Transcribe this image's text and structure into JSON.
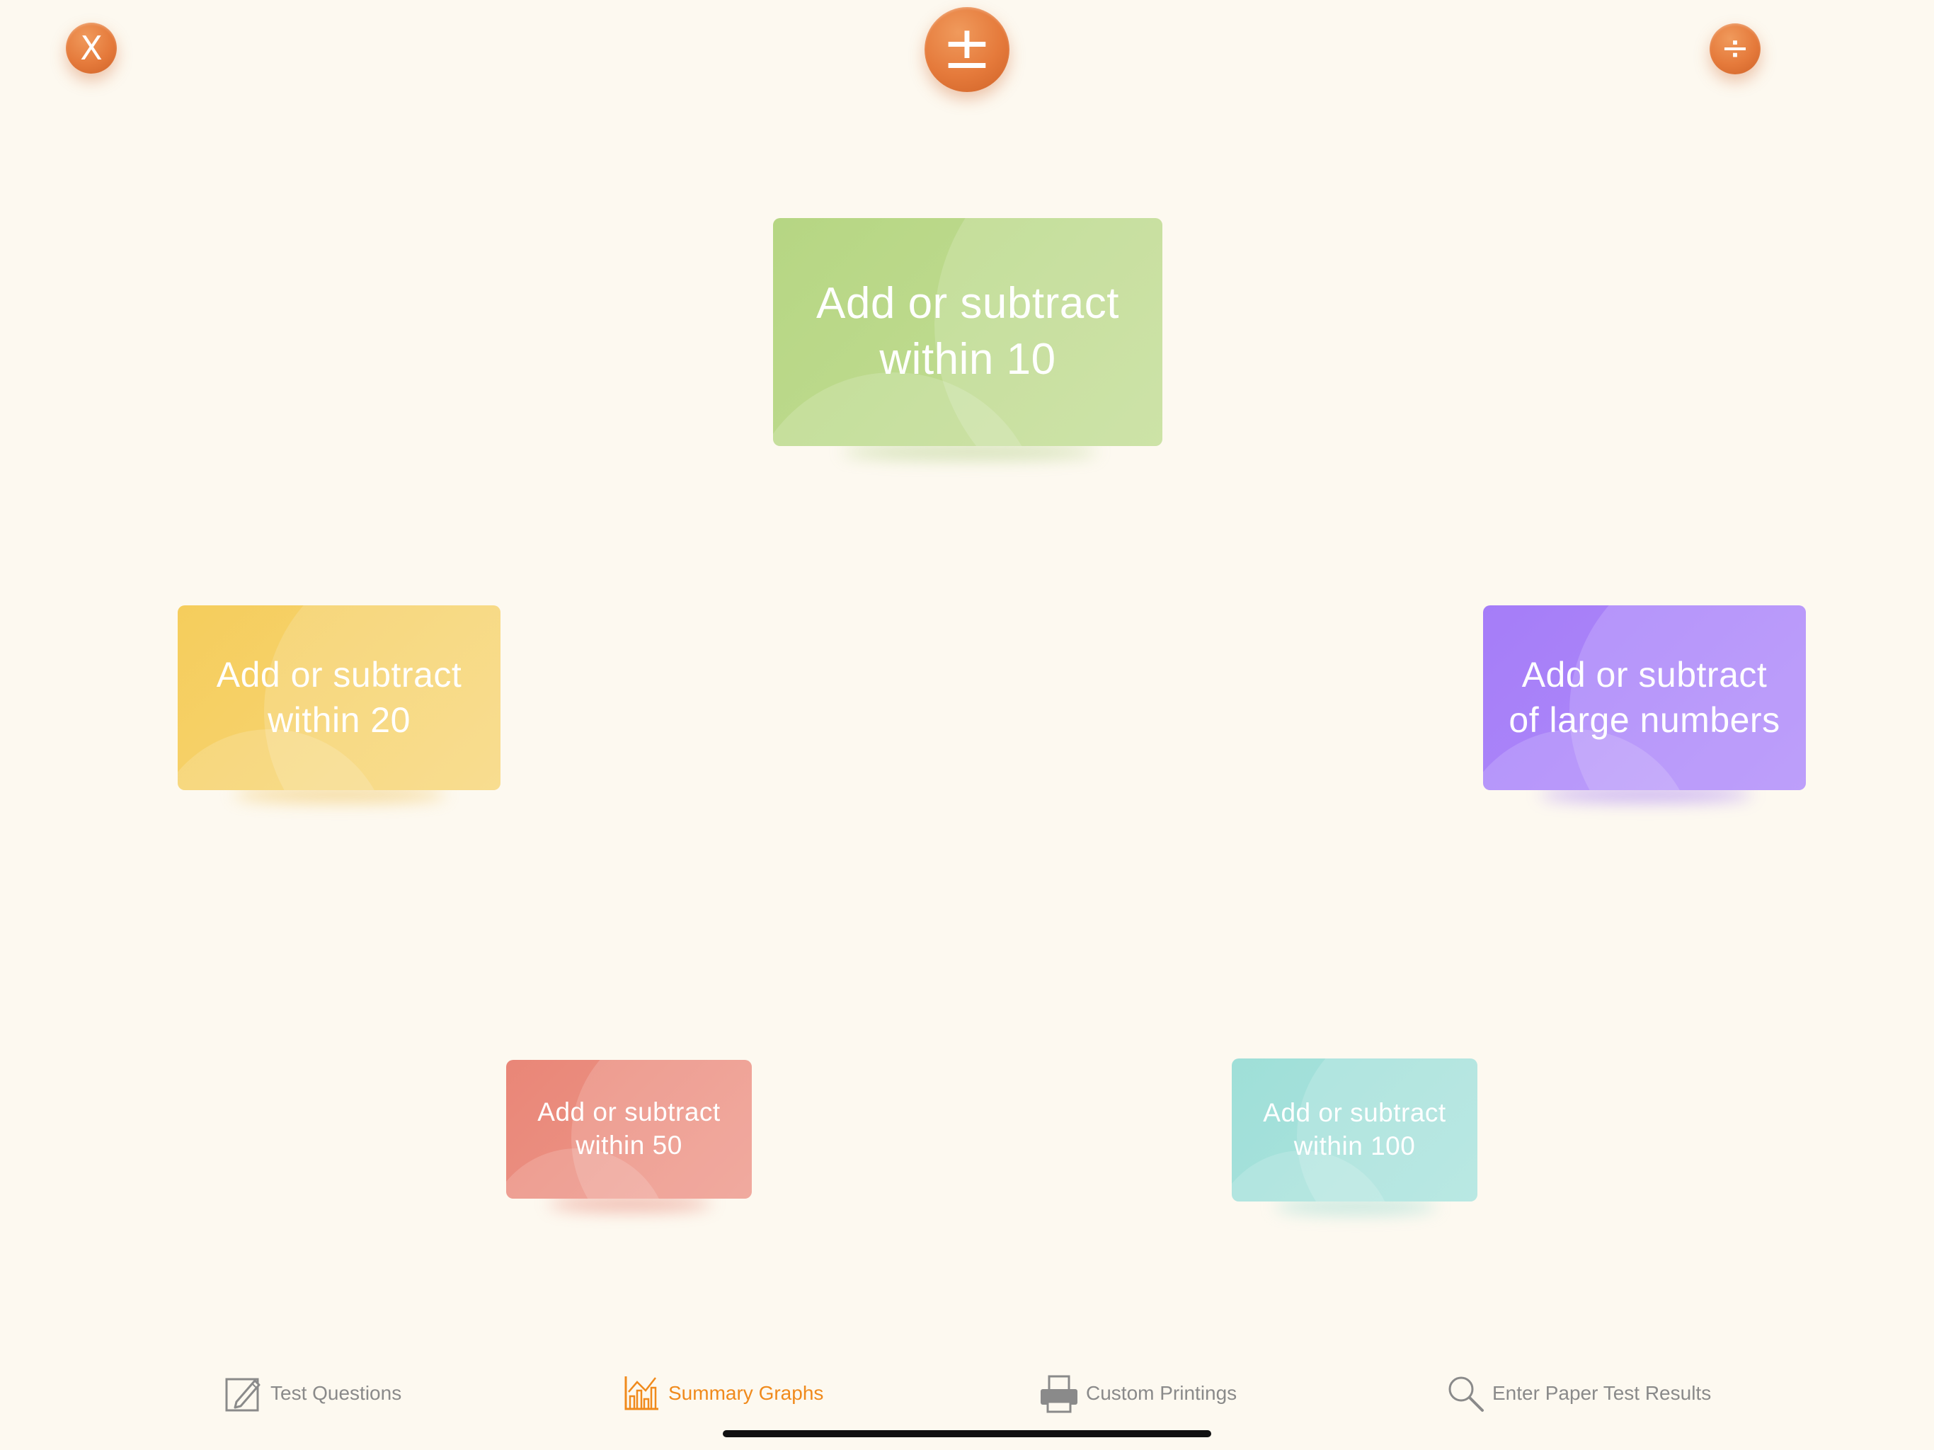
{
  "header": {
    "close_label": "X",
    "mode_symbol": "±",
    "divide_symbol": "÷"
  },
  "cards": {
    "within_10": {
      "line1": "Add or subtract",
      "line2": "within 10",
      "color": "#b6d683"
    },
    "within_20": {
      "line1": "Add or subtract",
      "line2": "within 20",
      "color": "#f5cd5c"
    },
    "large_numbers": {
      "line1": "Add or subtract",
      "line2": "of large numbers",
      "color": "#a57df8"
    },
    "within_50": {
      "line1": "Add or subtract",
      "line2": "within 50",
      "color": "#e98677"
    },
    "within_100": {
      "line1": "Add or subtract",
      "line2": "within 100",
      "color": "#9fdfd8"
    }
  },
  "tabbar": {
    "tabs": [
      {
        "label": "Test Questions",
        "icon": "pencil-icon",
        "active": false
      },
      {
        "label": "Summary Graphs",
        "icon": "bar-graph-icon",
        "active": true
      },
      {
        "label": "Custom Printings",
        "icon": "printer-icon",
        "active": false
      },
      {
        "label": "Enter Paper Test Results",
        "icon": "magnifier-icon",
        "active": false
      }
    ],
    "active_color": "#f08a1c",
    "inactive_color": "#8a8a8a"
  },
  "theme": {
    "background": "#fdf9f0",
    "accent": "#e57a3b"
  }
}
